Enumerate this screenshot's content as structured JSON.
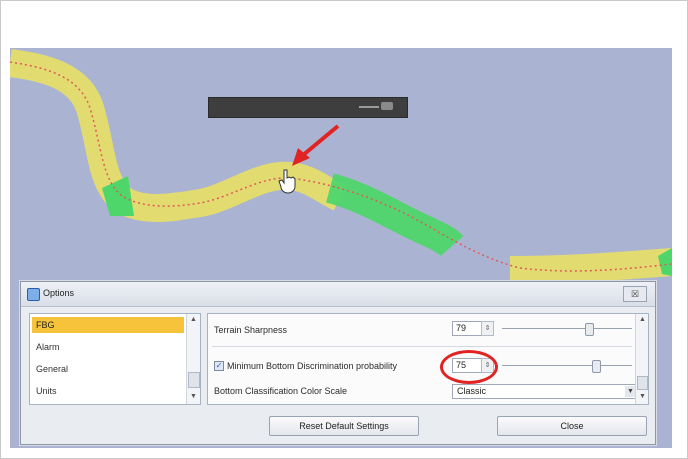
{
  "dialog": {
    "title": "Options",
    "close_glyph": "☒"
  },
  "categories": [
    {
      "label": "FBG",
      "selected": true
    },
    {
      "label": "Alarm",
      "selected": false
    },
    {
      "label": "General",
      "selected": false
    },
    {
      "label": "Units",
      "selected": false
    }
  ],
  "settings": {
    "terrain_sharpness": {
      "label": "Terrain Sharpness",
      "value": "79",
      "level": 0.79
    },
    "min_bottom_discrimination": {
      "label": "Minimum Bottom Discrimination probability",
      "value": "75",
      "level": 0.75,
      "checked": true
    },
    "bottom_color_scale": {
      "label": "Bottom Classification Color Scale",
      "value": "Classic"
    }
  },
  "buttons": {
    "reset": "Reset Default Settings",
    "close": "Close"
  },
  "icons": {
    "cursor": "hand-cursor-icon",
    "pointer_arrow": "red-arrow-icon",
    "title_icon": "options-window-icon"
  },
  "colors": {
    "map_background": "#aab4d2",
    "track_yellow": "#e5dd6a",
    "track_green": "#4fd66a",
    "track_line": "#e05a5a",
    "selected_item": "#f6c33a",
    "highlight": "#e02424"
  }
}
